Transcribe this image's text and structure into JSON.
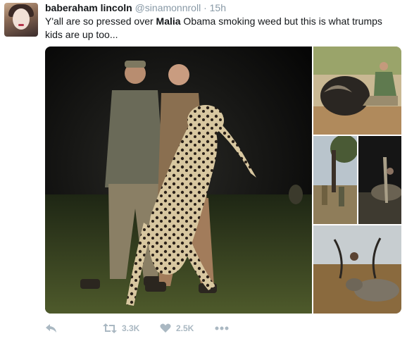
{
  "tweet": {
    "display_name": "baberaham lincoln",
    "handle": "@sinamonnroll",
    "separator": "·",
    "time": "15h",
    "text_part1": "Y'all are so pressed over ",
    "text_bold": "Malia",
    "text_part2": " Obama smoking weed but this is what trumps kids are up too..."
  },
  "media": {
    "photo_count": 5,
    "icon": "photo-grid"
  },
  "actions": {
    "reply_icon": "reply-icon",
    "retweet_icon": "retweet-icon",
    "retweet_count": "3.3K",
    "like_icon": "heart-icon",
    "like_count": "2.5K",
    "more_icon": "more-dots-icon"
  },
  "colors": {
    "text": "#14171a",
    "muted": "#8899a6",
    "action_icon": "#aab8c2"
  }
}
